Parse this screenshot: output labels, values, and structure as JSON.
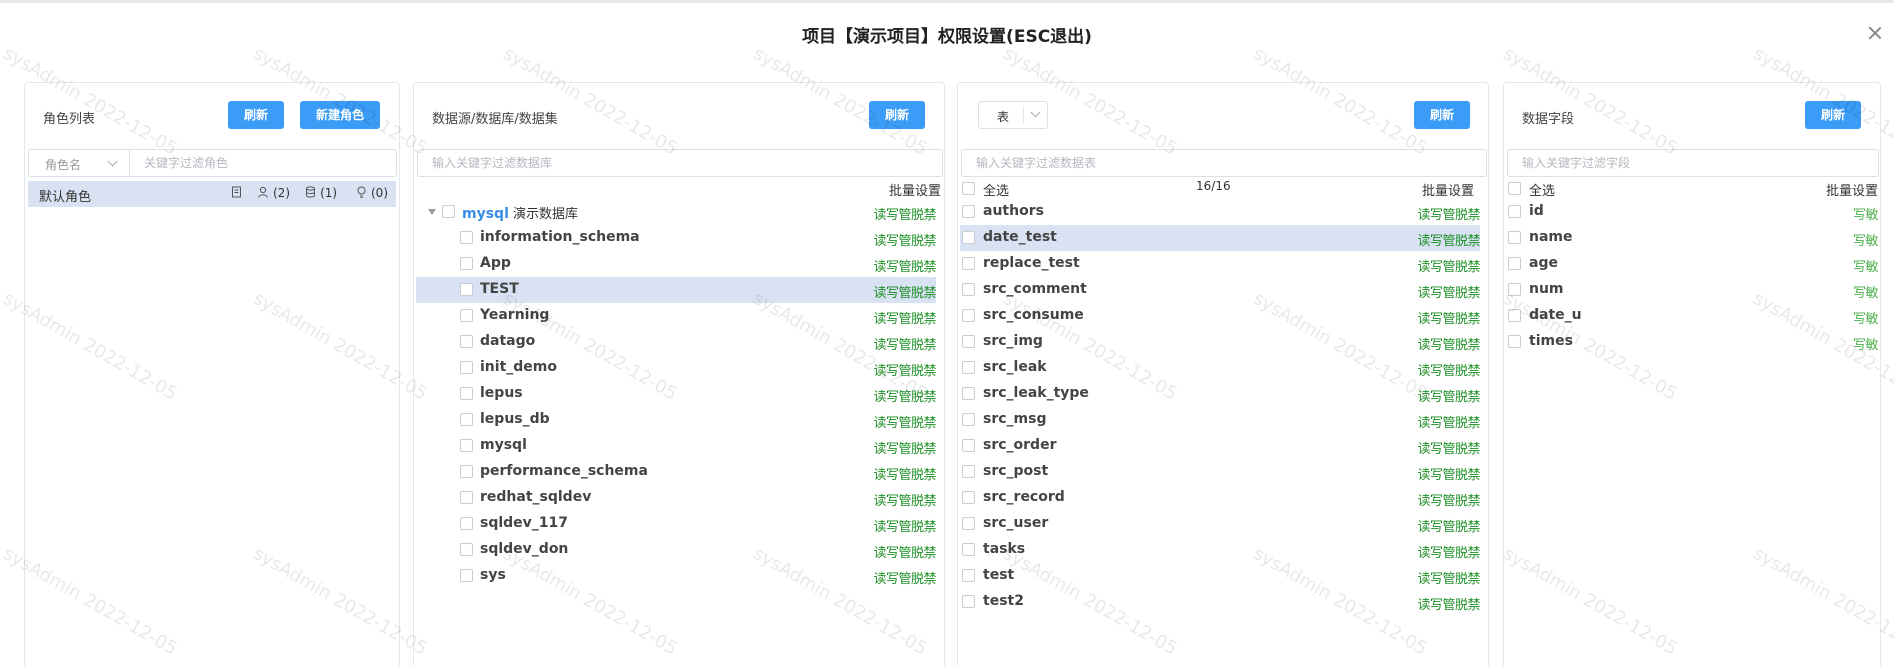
{
  "dialog": {
    "title": "项目【演示项目】权限设置(ESC退出)"
  },
  "watermark": "sysAdmin 2022-12-05",
  "roles_panel": {
    "title": "角色列表",
    "refresh_label": "刷新",
    "new_role_label": "新建角色",
    "filter_select_label": "角色名",
    "search_placeholder": "关键字过滤角色",
    "roles": [
      {
        "name": "默认角色",
        "stat_users": "(2)",
        "stat_dbs": "(1)",
        "stat_ideas": "(0)"
      }
    ]
  },
  "db_panel": {
    "title": "数据源/数据库/数据集",
    "refresh_label": "刷新",
    "search_placeholder": "输入关键字过滤数据库",
    "batch_label": "批量设置",
    "source": {
      "type": "mysql",
      "name": "演示数据库",
      "perm": "读写管脱禁"
    },
    "databases": [
      {
        "name": "information_schema",
        "perm": "读写管脱禁"
      },
      {
        "name": "App",
        "perm": "读写管脱禁"
      },
      {
        "name": "TEST",
        "perm": "读写管脱禁"
      },
      {
        "name": "Yearning",
        "perm": "读写管脱禁"
      },
      {
        "name": "datago",
        "perm": "读写管脱禁"
      },
      {
        "name": "init_demo",
        "perm": "读写管脱禁"
      },
      {
        "name": "lepus",
        "perm": "读写管脱禁"
      },
      {
        "name": "lepus_db",
        "perm": "读写管脱禁"
      },
      {
        "name": "mysql",
        "perm": "读写管脱禁"
      },
      {
        "name": "performance_schema",
        "perm": "读写管脱禁"
      },
      {
        "name": "redhat_sqldev",
        "perm": "读写管脱禁"
      },
      {
        "name": "sqldev_117",
        "perm": "读写管脱禁"
      },
      {
        "name": "sqldev_don",
        "perm": "读写管脱禁"
      },
      {
        "name": "sys",
        "perm": "读写管脱禁"
      }
    ]
  },
  "table_panel": {
    "type_select": "表",
    "refresh_label": "刷新",
    "search_placeholder": "输入关键字过滤数据表",
    "select_all": "全选",
    "count": "16/16",
    "batch_label": "批量设置",
    "tables": [
      {
        "name": "authors",
        "perm": "读写管脱禁"
      },
      {
        "name": "date_test",
        "perm": "读写管脱禁"
      },
      {
        "name": "replace_test",
        "perm": "读写管脱禁"
      },
      {
        "name": "src_comment",
        "perm": "读写管脱禁"
      },
      {
        "name": "src_consume",
        "perm": "读写管脱禁"
      },
      {
        "name": "src_img",
        "perm": "读写管脱禁"
      },
      {
        "name": "src_leak",
        "perm": "读写管脱禁"
      },
      {
        "name": "src_leak_type",
        "perm": "读写管脱禁"
      },
      {
        "name": "src_msg",
        "perm": "读写管脱禁"
      },
      {
        "name": "src_order",
        "perm": "读写管脱禁"
      },
      {
        "name": "src_post",
        "perm": "读写管脱禁"
      },
      {
        "name": "src_record",
        "perm": "读写管脱禁"
      },
      {
        "name": "src_user",
        "perm": "读写管脱禁"
      },
      {
        "name": "tasks",
        "perm": "读写管脱禁"
      },
      {
        "name": "test",
        "perm": "读写管脱禁"
      },
      {
        "name": "test2",
        "perm": "读写管脱禁"
      }
    ]
  },
  "field_panel": {
    "title": "数据字段",
    "refresh_label": "刷新",
    "search_placeholder": "输入关键字过滤字段",
    "select_all": "全选",
    "batch_label": "批量设置",
    "fields": [
      {
        "name": "id",
        "perm": "写敏"
      },
      {
        "name": "name",
        "perm": "写敏"
      },
      {
        "name": "age",
        "perm": "写敏"
      },
      {
        "name": "num",
        "perm": "写敏"
      },
      {
        "name": "date_u",
        "perm": "写敏"
      },
      {
        "name": "times",
        "perm": "写敏"
      }
    ]
  }
}
